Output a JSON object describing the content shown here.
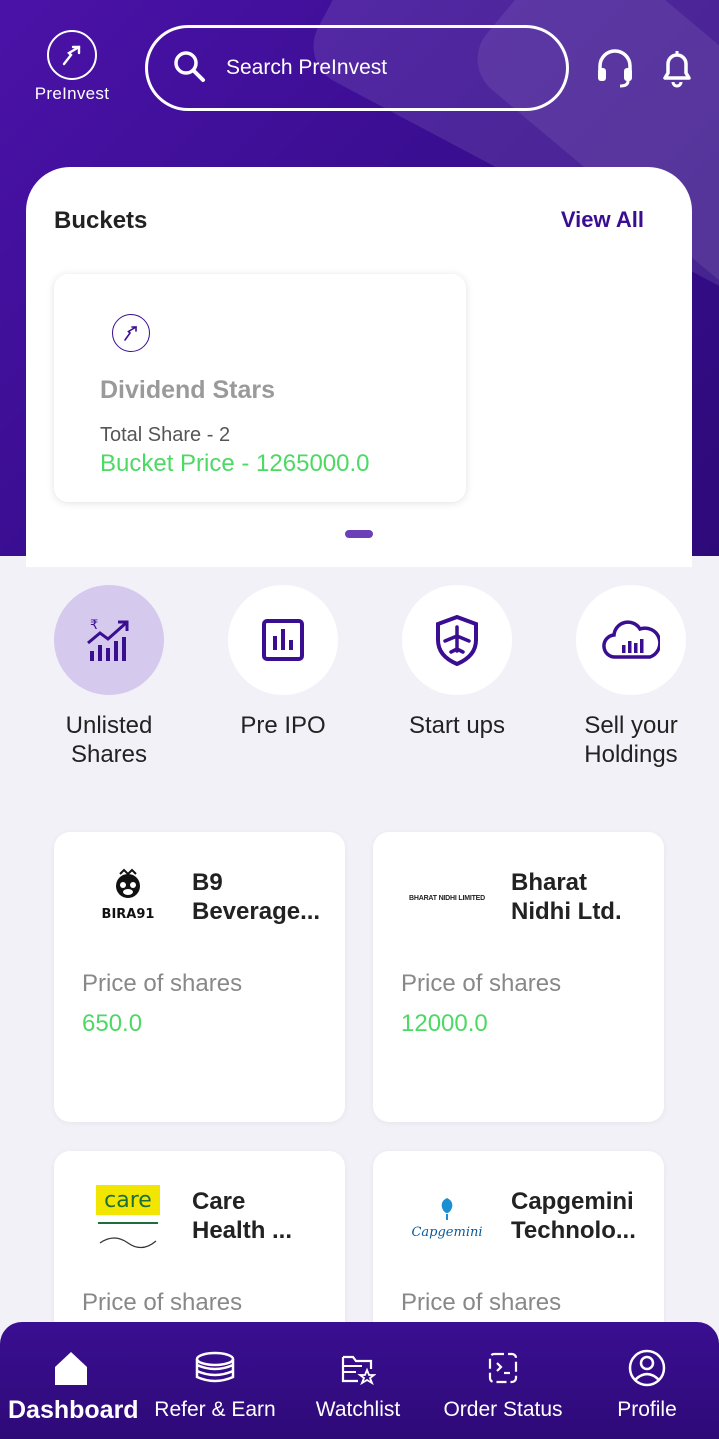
{
  "header": {
    "logo_text": "PreInvest",
    "search_placeholder": "Search PreInvest",
    "support_icon": "headset-icon",
    "notification_icon": "bell-icon"
  },
  "buckets": {
    "title": "Buckets",
    "view_all": "View All",
    "items": [
      {
        "name": "Dividend Stars",
        "total_share": "Total Share - 2",
        "price": "Bucket Price - 1265000.0"
      }
    ]
  },
  "categories": [
    {
      "label_line1": "Unlisted",
      "label_line2": "Shares",
      "icon": "rupee-chart-icon",
      "active": true
    },
    {
      "label_line1": "Pre IPO",
      "label_line2": "",
      "icon": "bar-chart-icon",
      "active": false
    },
    {
      "label_line1": "Start ups",
      "label_line2": "",
      "icon": "shield-plane-icon",
      "active": false
    },
    {
      "label_line1": "Sell your",
      "label_line2": "Holdings",
      "icon": "cloud-chart-icon",
      "active": false
    }
  ],
  "stocks": [
    {
      "name_line1": "B9",
      "name_line2": "Beverage...",
      "logo_text": "BIRA91",
      "price_label": "Price of shares",
      "price": "650.0"
    },
    {
      "name_line1": "Bharat",
      "name_line2": "Nidhi Ltd.",
      "logo_text": "BHARAT NIDHI LIMITED",
      "price_label": "Price of shares",
      "price": "12000.0"
    },
    {
      "name_line1": "Care",
      "name_line2": "Health ...",
      "logo_text": "care",
      "price_label": "Price of shares",
      "price": ""
    },
    {
      "name_line1": "Capgemini",
      "name_line2": "Technolo...",
      "logo_text": "Capgemini",
      "price_label": "Price of shares",
      "price": ""
    }
  ],
  "nav": [
    {
      "label": "Dashboard",
      "icon": "home-icon",
      "active": true
    },
    {
      "label": "Refer & Earn",
      "icon": "coins-icon",
      "active": false
    },
    {
      "label": "Watchlist",
      "icon": "watchlist-icon",
      "active": false
    },
    {
      "label": "Order Status",
      "icon": "order-status-icon",
      "active": false
    },
    {
      "label": "Profile",
      "icon": "profile-icon",
      "active": false
    }
  ],
  "colors": {
    "primary": "#3a0e91",
    "price_green": "#4cd964",
    "active_category": "#d6c9ee"
  }
}
